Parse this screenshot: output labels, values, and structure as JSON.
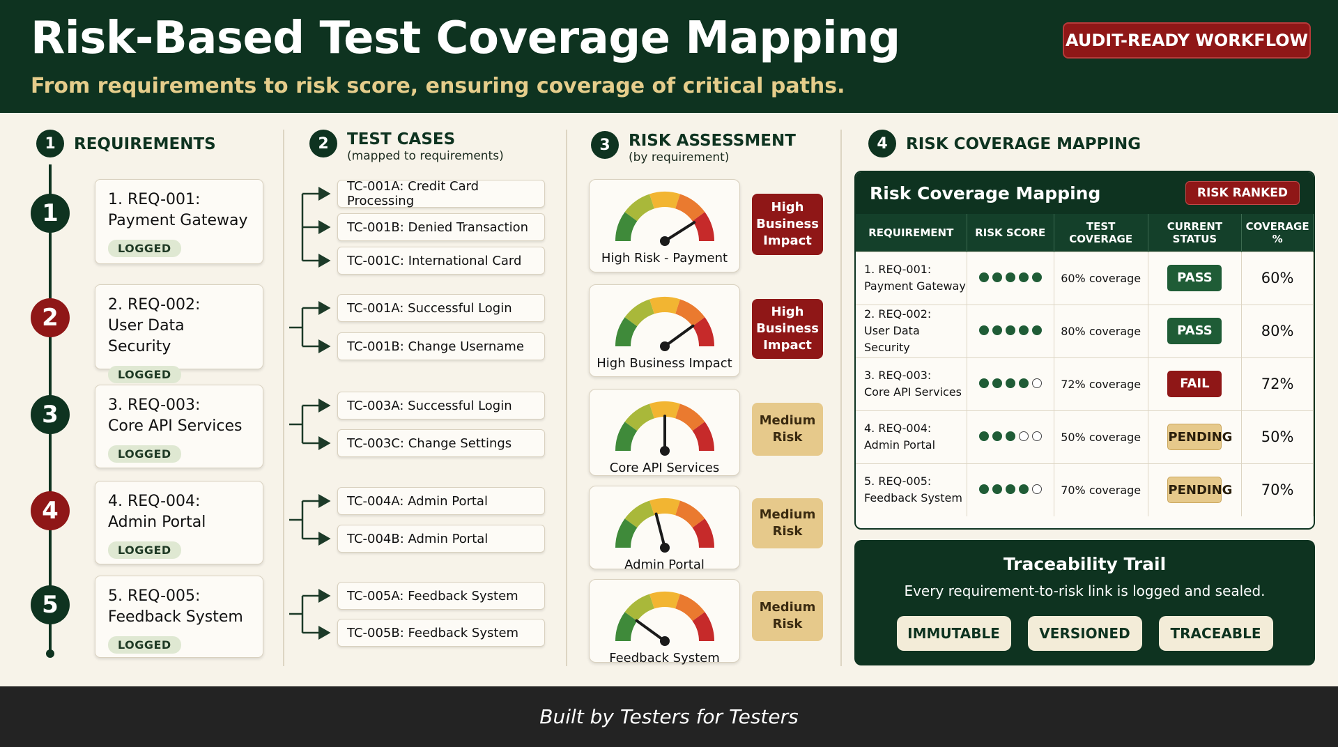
{
  "header": {
    "title": "Risk-Based Test Coverage Mapping",
    "subtitle": "From requirements to risk score, ensuring coverage of critical paths.",
    "badge": "AUDIT-READY WORKFLOW"
  },
  "sections": {
    "requirements": {
      "num": "1",
      "title": "REQUIREMENTS"
    },
    "test_cases": {
      "num": "2",
      "title": "TEST CASES",
      "sub": "(mapped to requirements)"
    },
    "risk_assessment": {
      "num": "3",
      "title": "RISK ASSESSMENT",
      "sub": "(by requirement)"
    },
    "risk_mapping": {
      "num": "4",
      "title": "RISK COVERAGE MAPPING"
    }
  },
  "requirements": [
    {
      "num": "1",
      "line1": "1. REQ-001:",
      "line2": "Payment Gateway",
      "badge": "LOGGED"
    },
    {
      "num": "2",
      "line1": "2. REQ-002:",
      "line2": "User Data Security",
      "badge": "LOGGED"
    },
    {
      "num": "3",
      "line1": "3. REQ-003:",
      "line2": "Core API Services",
      "badge": "LOGGED"
    },
    {
      "num": "4",
      "line1": "4. REQ-004:",
      "line2": "Admin Portal",
      "badge": "LOGGED"
    },
    {
      "num": "5",
      "line1": "5. REQ-005:",
      "line2": "Feedback System",
      "badge": "LOGGED"
    }
  ],
  "test_cases": [
    "TC-001A: Credit Card Processing",
    "TC-001B: Denied Transaction",
    "TC-001C: International Card",
    "TC-001A: Successful Login",
    "TC-001B: Change Username",
    "TC-003A: Successful Login",
    "TC-003C: Change Settings",
    "TC-004A: Admin Portal",
    "TC-004B: Admin Portal",
    "TC-005A: Feedback System",
    "TC-005B: Feedback System"
  ],
  "risk_assessment": [
    {
      "label": "High Risk - Payment",
      "tag": "High Business Impact",
      "level": 0.82
    },
    {
      "label": "High Business Impact",
      "tag": "High Business Impact",
      "level": 0.8
    },
    {
      "label": "Core API Services",
      "tag": "Medium Risk",
      "level": 0.5
    },
    {
      "label": "Admin Portal",
      "tag": "Medium Risk",
      "level": 0.42
    },
    {
      "label": "Feedback System",
      "tag": "Medium Risk",
      "level": 0.2
    }
  ],
  "mapping": {
    "title": "Risk Coverage Mapping",
    "badge": "RISK RANKED",
    "columns": [
      "REQUIREMENT",
      "RISK SCORE",
      "TEST COVERAGE",
      "CURRENT STATUS",
      "COVERAGE %"
    ],
    "rows": [
      {
        "req1": "1. REQ-001:",
        "req2": "Payment Gateway",
        "score": 5,
        "coverage": "60% coverage",
        "status": "PASS",
        "pct": "60%"
      },
      {
        "req1": "2. REQ-002:",
        "req2": "User Data Security",
        "score": 5,
        "coverage": "80% coverage",
        "status": "PASS",
        "pct": "80%"
      },
      {
        "req1": "3. REQ-003:",
        "req2": "Core API Services",
        "score": 4,
        "coverage": "72% coverage",
        "status": "FAIL",
        "pct": "72%"
      },
      {
        "req1": "4. REQ-004:",
        "req2": "Admin Portal",
        "score": 3,
        "coverage": "50% coverage",
        "status": "PENDING",
        "pct": "50%"
      },
      {
        "req1": "5. REQ-005:",
        "req2": "Feedback System",
        "score": 4,
        "coverage": "70% coverage",
        "status": "PENDING",
        "pct": "70%"
      }
    ]
  },
  "trace": {
    "title": "Traceability Trail",
    "desc": "Every requirement-to-risk link is logged and sealed.",
    "tags": [
      "IMMUTABLE",
      "VERSIONED",
      "TRACEABLE"
    ]
  },
  "footer": "Built by Testers for Testers",
  "colors": {
    "primary": "#0e3320",
    "danger": "#8f1717",
    "accent": "#e5cd8b",
    "medium": "#e6c98b"
  }
}
